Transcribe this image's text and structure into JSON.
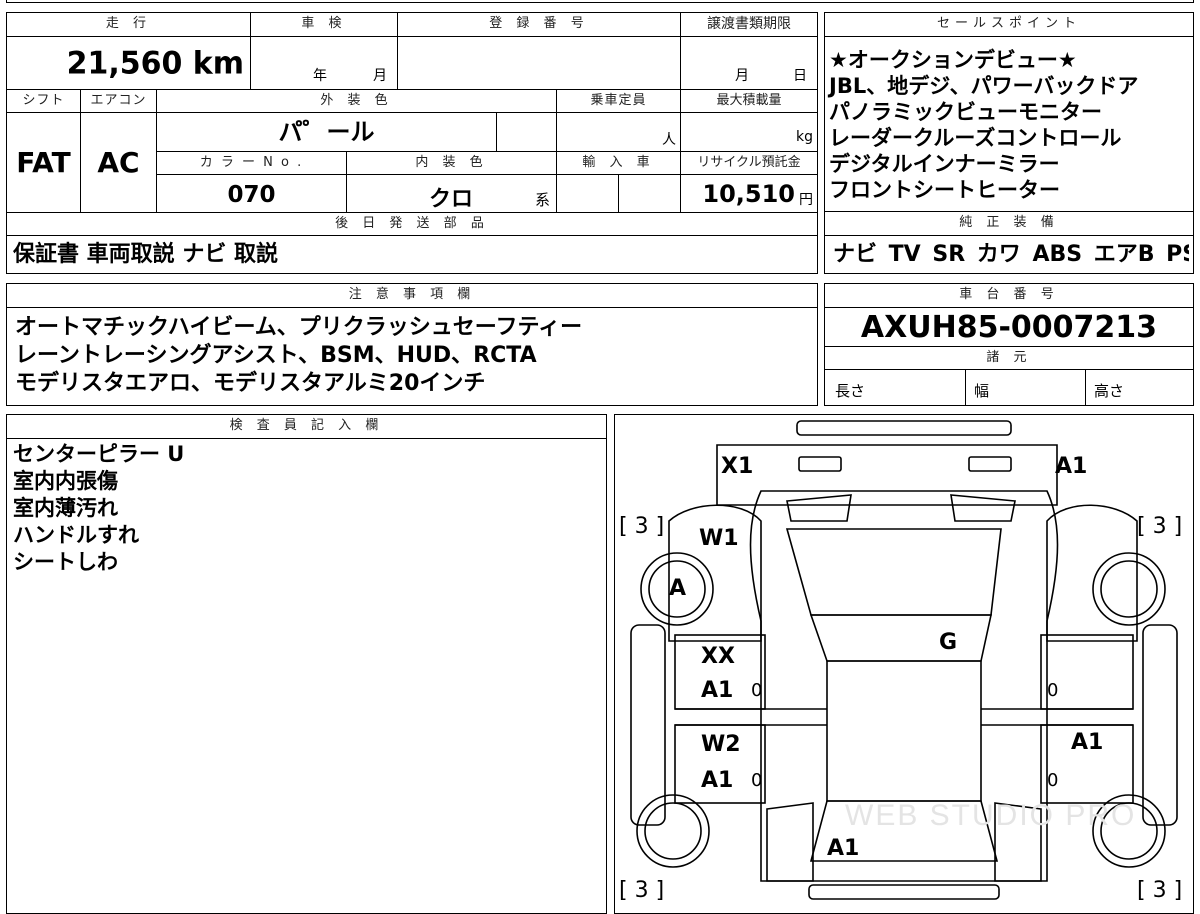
{
  "top_table": {
    "mileage_header": "走 行",
    "mileage_value": "21,560 km",
    "inspection_header": "車 検",
    "inspection_year": "年",
    "inspection_month": "月",
    "registration_header": "登 録 番 号",
    "transfer_header": "譲渡書類期限",
    "transfer_month": "月",
    "transfer_day": "日",
    "shift_header": "シフト",
    "shift_value": "FAT",
    "ac_header": "エアコン",
    "ac_value": "AC",
    "exterior_header": "外 装 色",
    "exterior_value": "パ゜ール",
    "capacity_header": "乗車定員",
    "capacity_unit": "人",
    "maxload_header": "最大積載量",
    "maxload_unit": "kg",
    "color_no_header": "カ ラ ー N o .",
    "color_no_value": "070",
    "interior_header": "内 装 色",
    "interior_value": "クロ",
    "interior_suffix": "系",
    "import_header": "輸 入 車",
    "recycle_header": "リサイクル預託金",
    "recycle_value": "10,510",
    "recycle_unit": "円",
    "later_parts_header": "後 日 発 送 部 品",
    "later_parts_value": "保証書 車両取説 ナビ 取説"
  },
  "sales_points": {
    "header": "セールスポイント",
    "lines": [
      "★オークションデビュー★",
      "JBL、地デジ、パワーバックドア",
      "パノラミックビューモニター",
      "レーダークルーズコントロール",
      "デジタルインナーミラー",
      "フロントシートヒーター"
    ]
  },
  "genuine_equipment": {
    "header": "純 正 装 備",
    "value": "ナビ TV SR カワ ABS エアB PS PW"
  },
  "notes": {
    "header": "注 意 事 項 欄",
    "lines": [
      "オートマチックハイビーム、プリクラッシュセーフティー",
      "レーントレーシングアシスト、BSM、HUD、RCTA",
      "モデリスタエアロ、モデリスタアルミ20インチ"
    ]
  },
  "chassis": {
    "header": "車 台 番 号",
    "value": "AXUH85-0007213",
    "specs_header": "諸 元",
    "length_label": "長さ",
    "width_label": "幅",
    "height_label": "高さ"
  },
  "inspector": {
    "header": "検 査 員 記 入 欄",
    "lines": [
      "センターピラー U",
      "室内内張傷",
      "室内薄汚れ",
      "ハンドルすれ",
      "シートしわ"
    ]
  },
  "diagram": {
    "tire_tl": "[ 3 ]",
    "tire_tr": "[ 3 ]",
    "tire_bl": "[ 3 ]",
    "tire_br": "[ 3 ]",
    "mark_x1": "X1",
    "mark_a1_front": "A1",
    "mark_w1": "W1",
    "mark_a_circle": "A",
    "mark_g": "G",
    "mark_xx": "XX",
    "mark_a1_ld": "A1",
    "mark_0_1": "0",
    "mark_0_2": "0",
    "mark_w2": "W2",
    "mark_a1_lr": "A1",
    "mark_0_3": "0",
    "mark_a1_rr": "A1",
    "mark_0_4": "0",
    "mark_a1_rear": "A1",
    "watermark": "WEB STUDIO PRO"
  }
}
